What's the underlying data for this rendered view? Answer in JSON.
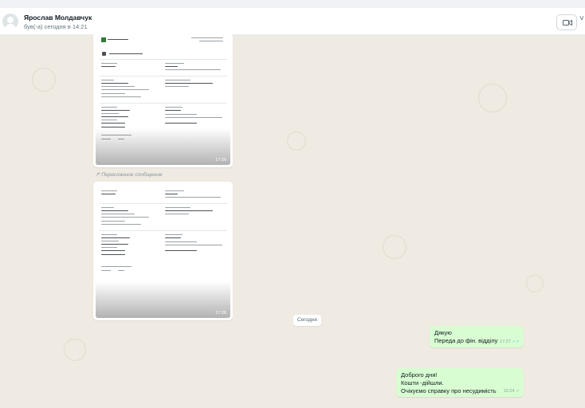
{
  "header": {
    "contact_name": "Ярослав Молдавчук",
    "last_seen": "був(-а) сегодня в 14:21",
    "video_icon": "video-camera-icon",
    "call_icon": "phone-icon"
  },
  "messages": {
    "image1": {
      "time": "17:26"
    },
    "forwarded_label": "Пересланное сообщение",
    "image2": {
      "time": "17:26"
    },
    "text1": {
      "lines": [
        "Дякую",
        "Переда до фін. відділу"
      ],
      "time": "17:27"
    },
    "date_separator": "Сегодня",
    "text2": {
      "lines": [
        "Доброго дня!",
        "Кошти -дійшли.",
        "Очікуємо справку про несудимість"
      ],
      "time": "10:24"
    }
  },
  "colors": {
    "chat_background": "#efeae2",
    "outgoing_bubble": "#d9fdd3",
    "read_ticks": "#53bdeb"
  }
}
